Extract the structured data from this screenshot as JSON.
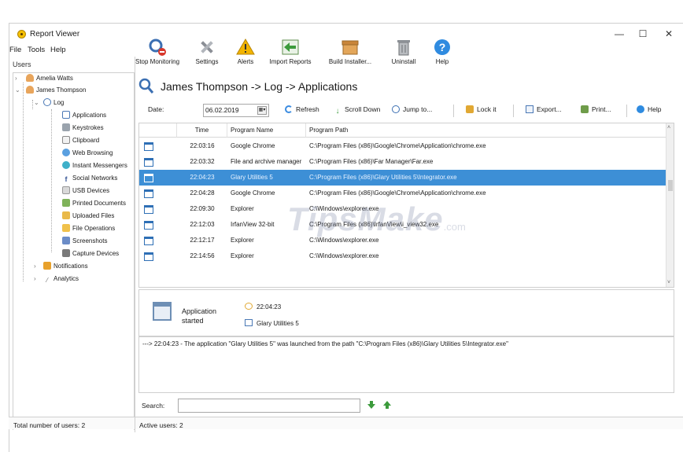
{
  "window": {
    "title": "Report Viewer",
    "controls": {
      "minimize": "—",
      "maximize": "☐",
      "close": "✕"
    }
  },
  "menu": [
    "File",
    "Tools",
    "Help"
  ],
  "sidebar": {
    "header": "Users",
    "users": [
      {
        "name": "Amelia Watts"
      },
      {
        "name": "James Thompson"
      }
    ],
    "log_label": "Log",
    "log_items": [
      "Applications",
      "Keystrokes",
      "Clipboard",
      "Web Browsing",
      "Instant Messengers",
      "Social Networks",
      "USB Devices",
      "Printed Documents",
      "Uploaded Files",
      "File Operations",
      "Screenshots",
      "Capture Devices"
    ],
    "notifications": "Notifications",
    "analytics": "Analytics"
  },
  "toolbar": [
    {
      "label": "Stop Monitoring",
      "icon": "stop-monitoring-icon"
    },
    {
      "label": "Settings",
      "icon": "tools-icon"
    },
    {
      "label": "Alerts",
      "icon": "warning-icon"
    },
    {
      "label": "Import Reports",
      "icon": "import-icon"
    },
    {
      "label": "Build Installer...",
      "icon": "box-icon"
    },
    {
      "label": "Uninstall",
      "icon": "trash-icon"
    },
    {
      "label": "Help",
      "icon": "help-icon"
    }
  ],
  "content": {
    "breadcrumb": "James Thompson -> Log -> Applications"
  },
  "filter": {
    "date_label": "Date:",
    "date_value": "06.02.2019",
    "refresh": "Refresh",
    "scroll_down": "Scroll Down",
    "jump_to": "Jump to...",
    "lock": "Lock it",
    "export": "Export...",
    "print": "Print...",
    "help": "Help"
  },
  "grid": {
    "columns": [
      "Time",
      "Program Name",
      "Program Path"
    ],
    "rows": [
      {
        "time": "22:03:16",
        "name": "Google Chrome",
        "path": "C:\\Program Files (x86)\\Google\\Chrome\\Application\\chrome.exe",
        "selected": false
      },
      {
        "time": "22:03:32",
        "name": "File and archive manager",
        "path": "C:\\Program Files (x86)\\Far Manager\\Far.exe",
        "selected": false
      },
      {
        "time": "22:04:23",
        "name": "Glary Utilities 5",
        "path": "C:\\Program Files (x86)\\Glary Utilities 5\\Integrator.exe",
        "selected": true
      },
      {
        "time": "22:04:28",
        "name": "Google Chrome",
        "path": "C:\\Program Files (x86)\\Google\\Chrome\\Application\\chrome.exe",
        "selected": false
      },
      {
        "time": "22:09:30",
        "name": "Explorer",
        "path": "C:\\Windows\\explorer.exe",
        "selected": false
      },
      {
        "time": "22:12:03",
        "name": "IrfanView 32-bit",
        "path": "C:\\Program Files (x86)\\IrfanView\\i_view32.exe",
        "selected": false
      },
      {
        "time": "22:12:17",
        "name": "Explorer",
        "path": "C:\\Windows\\explorer.exe",
        "selected": false
      },
      {
        "time": "22:14:56",
        "name": "Explorer",
        "path": "C:\\Windows\\explorer.exe",
        "selected": false
      }
    ]
  },
  "detail": {
    "event_line1": "Application",
    "event_line2": "started",
    "time": "22:04:23",
    "program": "Glary Utilities 5"
  },
  "log_text": "---> 22:04:23 - The application \"Glary Utilities 5\" was launched from the path \"C:\\Program Files (x86)\\Glary Utilities 5\\Integrator.exe\"",
  "search": {
    "label": "Search:",
    "value": ""
  },
  "status": {
    "total_users": "Total number of users: 2",
    "active_users": "Active users: 2"
  },
  "watermark": {
    "main": "TipsMake",
    "sub": ".com"
  },
  "colors": {
    "selection": "#3d8fd6",
    "accent_blue": "#2e6fb5"
  }
}
